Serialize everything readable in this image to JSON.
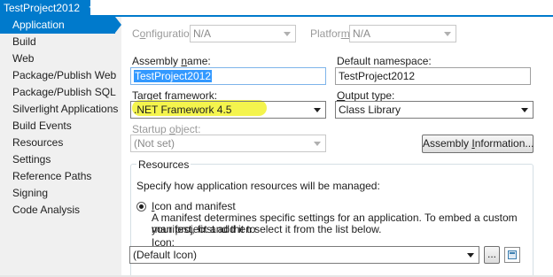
{
  "tab": {
    "title": "TestProject2012",
    "pin_glyph": "⇴",
    "close_glyph": "✕"
  },
  "sidebar": {
    "items": [
      {
        "label": "Application"
      },
      {
        "label": "Build"
      },
      {
        "label": "Web"
      },
      {
        "label": "Package/Publish Web"
      },
      {
        "label": "Package/Publish SQL"
      },
      {
        "label": "Silverlight Applications"
      },
      {
        "label": "Build Events"
      },
      {
        "label": "Resources"
      },
      {
        "label": "Settings"
      },
      {
        "label": "Reference Paths"
      },
      {
        "label": "Signing"
      },
      {
        "label": "Code Analysis"
      }
    ],
    "selected": "Application"
  },
  "config": {
    "configuration_label_pre": "C",
    "configuration_label_u": "o",
    "configuration_label_post": "nfiguration:",
    "configuration_value": "N/A",
    "platform_label_pre": "Platfor",
    "platform_label_u": "m",
    "platform_label_post": ":",
    "platform_value": "N/A"
  },
  "app": {
    "assembly_name_label_pre": "Assembly ",
    "assembly_name_label_u": "n",
    "assembly_name_label_post": "ame:",
    "assembly_name_value": "TestProject2012",
    "default_namespace_label_pre": "Default namespace:",
    "default_namespace_value": "TestProject2012",
    "target_framework_label_pre": "Tar",
    "target_framework_label_u": "g",
    "target_framework_label_post": "et framework:",
    "target_framework_value": ".NET Framework 4.5",
    "output_type_label_pre": "",
    "output_type_label_u": "O",
    "output_type_label_post": "utput type:",
    "output_type_value": "Class Library",
    "startup_object_label_pre": "Startup ",
    "startup_object_label_u": "o",
    "startup_object_label_post": "bject:",
    "startup_object_value": "(Not set)",
    "assembly_info_button_pre": "Assembly ",
    "assembly_info_button_u": "I",
    "assembly_info_button_post": "nformation..."
  },
  "resources": {
    "group_title": "Resources",
    "description": "Specify how application resources will be managed:",
    "icon_manifest_label_u": "I",
    "icon_manifest_label_post": "con and manifest",
    "icon_manifest_desc_1": "A manifest determines specific settings for an application. To embed a custom manifest, first add it to",
    "icon_manifest_desc_2": "your project and then select it from the list below.",
    "icon_label": "Icon:",
    "icon_value": "(Default Icon)",
    "browse_button": "...",
    "icon_manifest_selected": true
  },
  "colors": {
    "accent": "#007acc",
    "sidebar_bg": "#f0f0f0",
    "highlight": "#f3f33a",
    "selection": "#3399ff"
  }
}
